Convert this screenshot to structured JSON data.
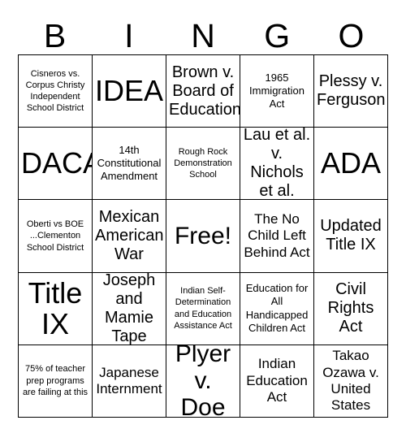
{
  "header": {
    "letters": [
      "B",
      "I",
      "N",
      "G",
      "O"
    ]
  },
  "grid": {
    "rows": [
      [
        {
          "text": "Cisneros vs. Corpus Christy Independent School District",
          "size": "xxs"
        },
        {
          "text": "IDEA",
          "size": "xl"
        },
        {
          "text": "Brown v. Board of Education",
          "size": "md"
        },
        {
          "text": "1965 Immigration Act",
          "size": "xs"
        },
        {
          "text": "Plessy v. Ferguson",
          "size": "md"
        }
      ],
      [
        {
          "text": "DACA",
          "size": "xl"
        },
        {
          "text": "14th Constitutional Amendment",
          "size": "xs"
        },
        {
          "text": "Rough Rock Demonstration School",
          "size": "xxs"
        },
        {
          "text": "Lau et al. v. Nichols et al.",
          "size": "md"
        },
        {
          "text": "ADA",
          "size": "xl"
        }
      ],
      [
        {
          "text": "Oberti vs BOE ...Clementon School District",
          "size": "xxs"
        },
        {
          "text": "Mexican American War",
          "size": "md"
        },
        {
          "text": "Free!",
          "size": "lg"
        },
        {
          "text": "The No Child Left Behind Act",
          "size": "sm"
        },
        {
          "text": "Updated Title IX",
          "size": "md"
        }
      ],
      [
        {
          "text": "Title IX",
          "size": "xl"
        },
        {
          "text": "Joseph and Mamie Tape",
          "size": "md"
        },
        {
          "text": "Indian Self-Determination and Education Assistance Act",
          "size": "xxs"
        },
        {
          "text": "Education for All Handicapped Children Act",
          "size": "xs"
        },
        {
          "text": "Civil Rights Act",
          "size": "md"
        }
      ],
      [
        {
          "text": "75% of teacher prep programs are failing at this",
          "size": "xxs"
        },
        {
          "text": "Japanese Internment",
          "size": "sm"
        },
        {
          "text": "Plyer v. Doe",
          "size": "lg"
        },
        {
          "text": "Indian Education Act",
          "size": "sm"
        },
        {
          "text": "Takao Ozawa v. United States",
          "size": "sm"
        }
      ]
    ]
  },
  "colors": {
    "background": "#ffffff",
    "text": "#000000",
    "border": "#000000"
  }
}
